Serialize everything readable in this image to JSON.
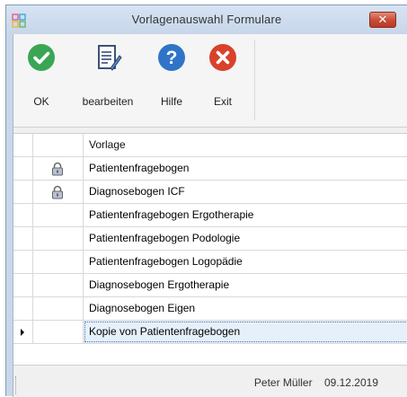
{
  "window": {
    "title": "Vorlagenauswahl Formulare",
    "close_label": "✕"
  },
  "toolbar": {
    "ok_label": "OK",
    "edit_label": "bearbeiten",
    "help_label": "Hilfe",
    "exit_label": "Exit",
    "ok_icon": "check-circle-icon",
    "edit_icon": "document-edit-icon",
    "help_icon": "question-circle-icon",
    "exit_icon": "x-circle-icon"
  },
  "grid": {
    "header": "Vorlage",
    "rows": [
      {
        "name": "Patientenfragebogen",
        "locked": true
      },
      {
        "name": "Diagnosebogen ICF",
        "locked": true
      },
      {
        "name": "Patientenfragebogen Ergotherapie",
        "locked": false
      },
      {
        "name": "Patientenfragebogen Podologie",
        "locked": false
      },
      {
        "name": "Patientenfragebogen Logopädie",
        "locked": false
      },
      {
        "name": "Diagnosebogen Ergotherapie",
        "locked": false
      },
      {
        "name": "Diagnosebogen Eigen",
        "locked": false
      },
      {
        "name": "Kopie von Patientenfragebogen",
        "locked": false,
        "selected": true
      }
    ]
  },
  "status": {
    "user": "Peter Müller",
    "date": "09.12.2019"
  },
  "colors": {
    "ok": "#3aa655",
    "help": "#2f74c8",
    "exit": "#d9412b",
    "selection": "#e6f0fb"
  }
}
